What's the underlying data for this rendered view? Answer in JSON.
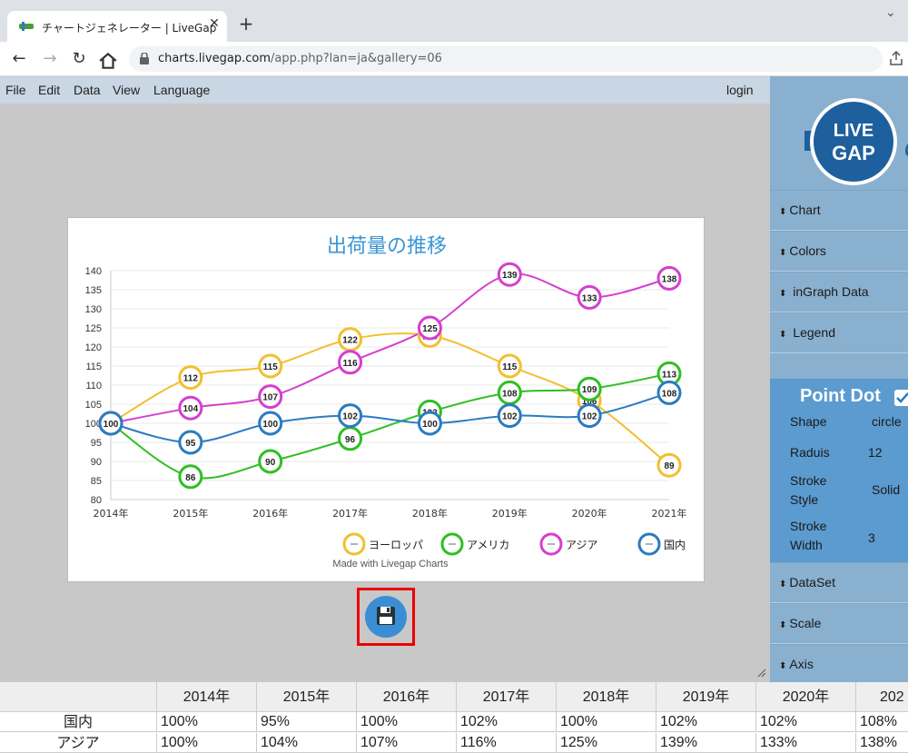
{
  "browser": {
    "tab_title": "チャートジェネレーター | LiveGap",
    "url_host": "charts.livegap.com",
    "url_path": "/app.php?lan=ja&gallery=06"
  },
  "menu": {
    "items": [
      "File",
      "Edit",
      "Data",
      "View",
      "Language"
    ],
    "login": "login"
  },
  "sidebar": {
    "logo_text": "LIVE GAP",
    "sections": [
      "Chart",
      "Colors",
      "inGraph Data",
      "Legend"
    ],
    "point_dot": {
      "title": "Point Dot",
      "rows": [
        {
          "label": "Shape",
          "value": "circle"
        },
        {
          "label": "Raduis",
          "value": "12"
        },
        {
          "label": "Stroke Style",
          "value": "Solid"
        },
        {
          "label": "Stroke Width",
          "value": "3"
        }
      ]
    },
    "sections_after": [
      "DataSet",
      "Scale",
      "Axis"
    ]
  },
  "chart_data": {
    "type": "line",
    "title": "出荷量の推移",
    "credit": "Made with Livegap Charts",
    "categories": [
      "2014年",
      "2015年",
      "2016年",
      "2017年",
      "2018年",
      "2019年",
      "2020年",
      "2021年"
    ],
    "ylim": [
      80,
      140
    ],
    "yticks": [
      80,
      85,
      90,
      95,
      100,
      105,
      110,
      115,
      120,
      125,
      130,
      135,
      140
    ],
    "grid": true,
    "legend_position": "bottom-right",
    "series": [
      {
        "name": "ヨーロッパ",
        "color": "#f2bf2e",
        "values": [
          100,
          112,
          115,
          122,
          123,
          115,
          106,
          89
        ]
      },
      {
        "name": "アメリカ",
        "color": "#2fbf22",
        "values": [
          100,
          86,
          90,
          96,
          103,
          108,
          109,
          113
        ]
      },
      {
        "name": "アジア",
        "color": "#d43fd0",
        "values": [
          100,
          104,
          107,
          116,
          125,
          139,
          133,
          138
        ]
      },
      {
        "name": "国内",
        "color": "#2a7bc0",
        "values": [
          100,
          95,
          100,
          102,
          100,
          102,
          102,
          108
        ]
      }
    ]
  },
  "table": {
    "columns": [
      "2014年",
      "2015年",
      "2016年",
      "2017年",
      "2018年",
      "2019年",
      "2020年",
      "202"
    ],
    "rows": [
      {
        "label": "国内",
        "cells": [
          "100%",
          "95%",
          "100%",
          "102%",
          "100%",
          "102%",
          "102%",
          "108%"
        ]
      },
      {
        "label": "アジア",
        "cells": [
          "100%",
          "104%",
          "107%",
          "116%",
          "125%",
          "139%",
          "133%",
          "138%"
        ]
      }
    ]
  }
}
